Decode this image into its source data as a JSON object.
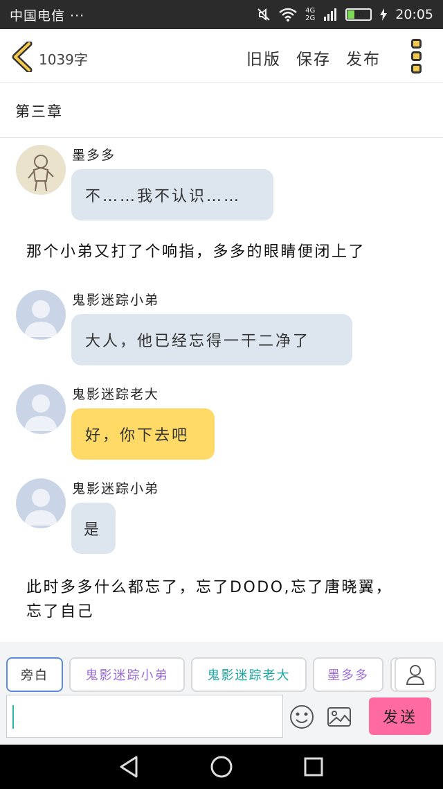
{
  "status": {
    "carrier": "中国电信 ···",
    "net_top": "4G",
    "net_bottom": "2G",
    "battery": "30",
    "time": "20:05"
  },
  "toolbar": {
    "wordcount": "1039字",
    "old_version": "旧版",
    "save": "保存",
    "publish": "发布"
  },
  "chapter": {
    "title": "第三章"
  },
  "messages": [
    {
      "speaker": "墨多多",
      "text": "不……我不认识……"
    },
    {
      "narration": "那个小弟又打了个响指，多多的眼睛便闭上了"
    },
    {
      "speaker": "鬼影迷踪小弟",
      "text": "大人，他已经忘得一干二净了"
    },
    {
      "speaker": "鬼影迷踪老大",
      "text": "好，你下去吧"
    },
    {
      "speaker": "鬼影迷踪小弟",
      "text": "是"
    },
    {
      "narration": "此时多多什么都忘了，忘了DODO,忘了唐晓翼，忘了自己"
    }
  ],
  "roles": {
    "narrator": "旁白",
    "role1": "鬼影迷踪小弟",
    "role2": "鬼影迷踪老大",
    "role3": "墨多多"
  },
  "composer": {
    "value": "",
    "send": "发送"
  },
  "icons": {
    "back": "back-chevron-icon",
    "menu": "more-menu-icon",
    "emoji": "emoji-icon",
    "image": "image-icon",
    "user": "user-icon"
  },
  "colors": {
    "accent_yellow": "#ffda66",
    "bubble_gray": "#dde5ef",
    "send_pink": "#ff6aa0",
    "teal": "#19a6a0",
    "purple": "#9a6bd6"
  }
}
